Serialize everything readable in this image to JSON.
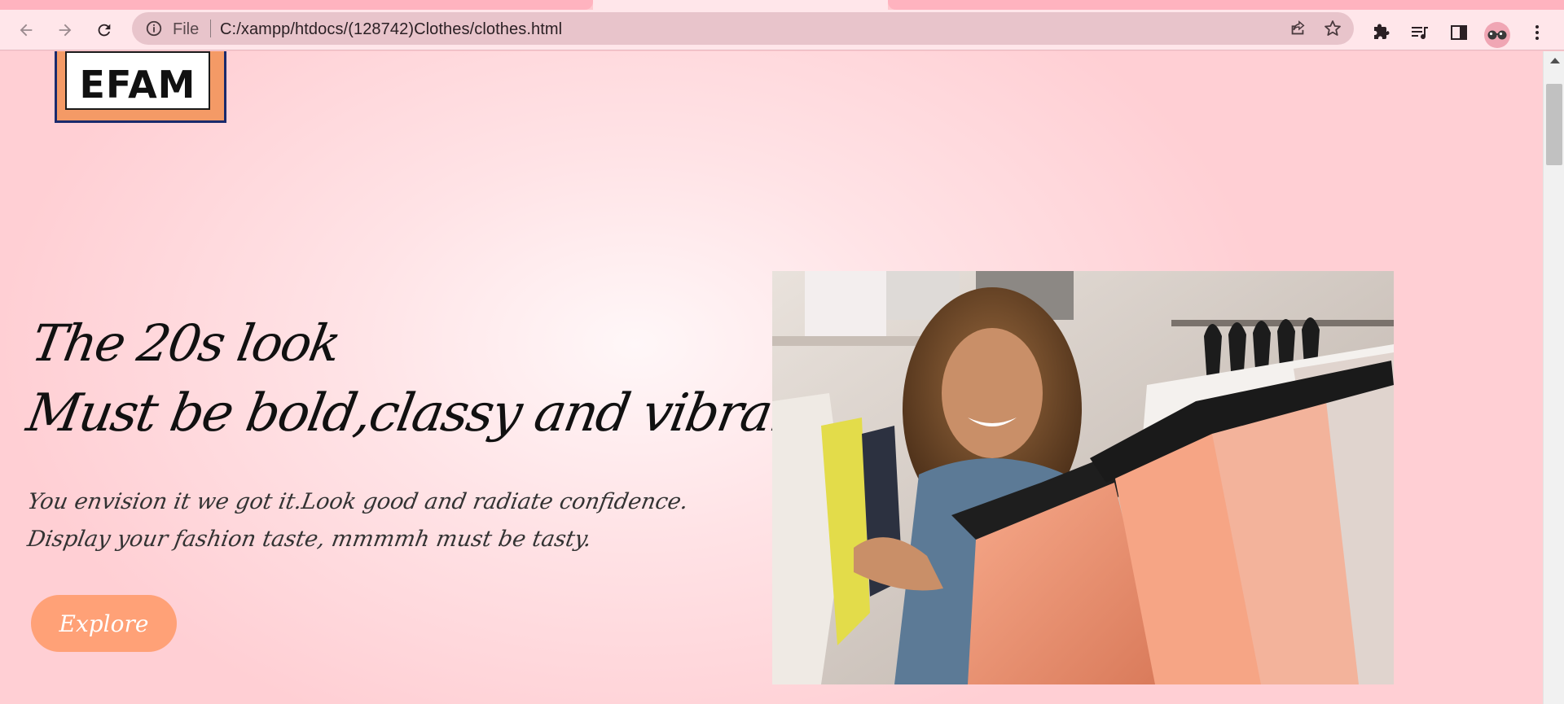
{
  "browser": {
    "url": "C:/xampp/htdocs/(128742)Clothes/clothes.html",
    "scheme_label": "File",
    "icons": [
      "back-arrow-icon",
      "forward-arrow-icon",
      "reload-icon",
      "info-icon",
      "share-icon",
      "star-icon",
      "extensions-icon",
      "media-icon",
      "side-panel-icon",
      "profile-avatar",
      "more-icon"
    ]
  },
  "colors": {
    "accent": "#ffa177",
    "logo_bg": "#f49a66",
    "logo_border": "#1a2a6c",
    "page_bg": "#ffcfd4"
  },
  "page": {
    "logo_text": "EFAM",
    "heading_line1": "The 20s look",
    "heading_line2": "Must be bold,classy and vibrant!",
    "subtitle_line1": "You envision it we got it.Look good and radiate confidence.",
    "subtitle_line2": "Display your fashion taste, mmmmh must be tasty.",
    "cta_label": "Explore"
  }
}
